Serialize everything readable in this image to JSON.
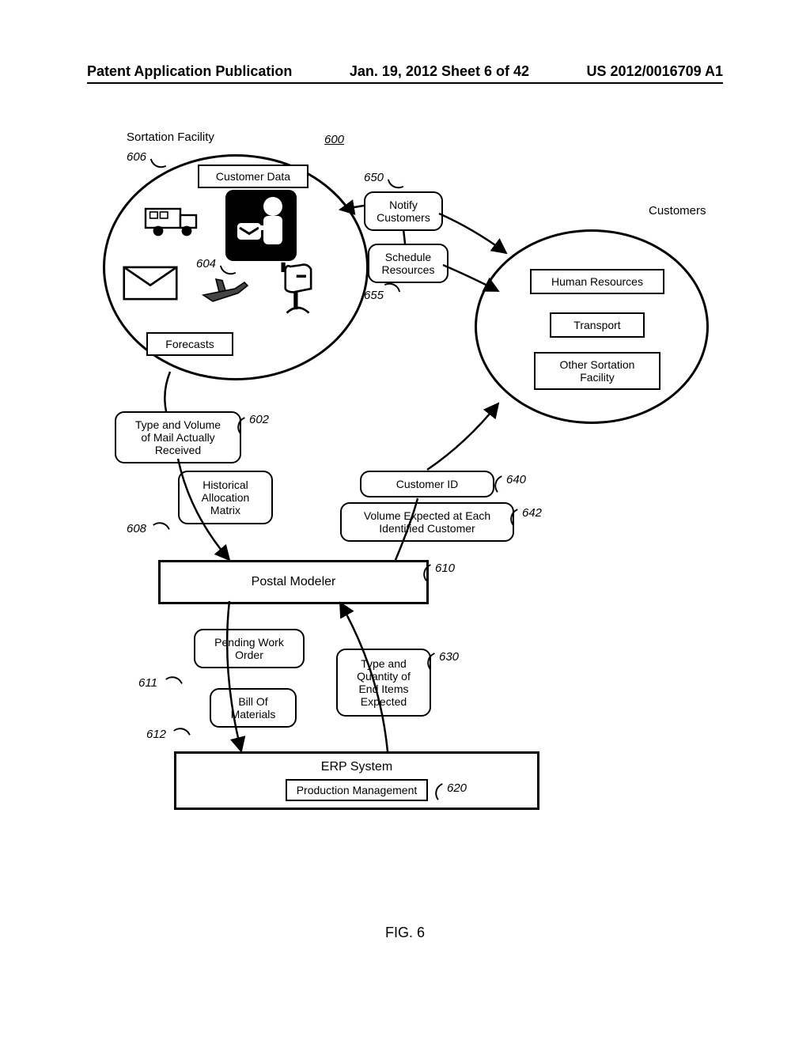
{
  "header": {
    "left": "Patent Application Publication",
    "center": "Jan. 19, 2012  Sheet 6 of 42",
    "right": "US 2012/0016709 A1"
  },
  "labels": {
    "sortation_facility": "Sortation Facility",
    "customers_group": "Customers",
    "customer_data": "Customer Data",
    "forecasts": "Forecasts",
    "notify_customers": "Notify\nCustomers",
    "schedule_resources": "Schedule\nResources",
    "human_resources": "Human Resources",
    "transport": "Transport",
    "other_sortation": "Other Sortation\nFacility",
    "type_volume_received": "Type and Volume\nof Mail Actually\nReceived",
    "historical_allocation": "Historical\nAllocation\nMatrix",
    "customer_id": "Customer ID",
    "volume_expected": "Volume Expected at Each\nIdentified Customer",
    "postal_modeler": "Postal Modeler",
    "pending_work_order": "Pending Work\nOrder",
    "bill_of_materials": "Bill Of\nMaterials",
    "type_qty_expected": "Type and\nQuantity of\nEnd Items\nExpected",
    "erp_system": "ERP System",
    "production_mgmt": "Production Management"
  },
  "refs": {
    "r600": "600",
    "r606": "606",
    "r604": "604",
    "r650": "650",
    "r655": "655",
    "r602": "602",
    "r608": "608",
    "r640": "640",
    "r642": "642",
    "r610": "610",
    "r611": "611",
    "r612": "612",
    "r630": "630",
    "r620": "620"
  },
  "figure": "FIG. 6"
}
